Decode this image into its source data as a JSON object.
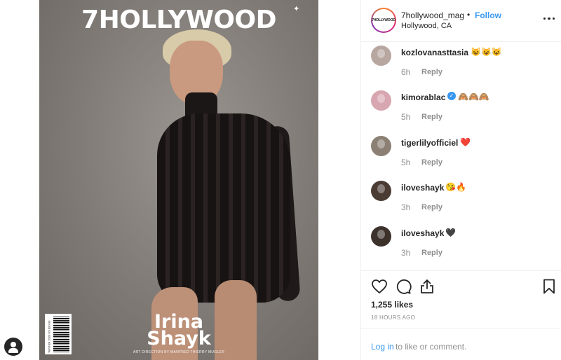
{
  "cover": {
    "brand": "7HOLLYWOOD",
    "name_line1": "Irina",
    "name_line2": "Shayk",
    "credit": "ART DIRECTION BY MANFRED THIERRY MUGLER",
    "issue": "WINTER 2020 US $20.00"
  },
  "post": {
    "avatar_logo": "7HOLLYWOOD",
    "username": "7hollywood_mag",
    "separator": "•",
    "follow_label": "Follow",
    "location": "Hollywood, CA"
  },
  "comments": [
    {
      "user": "kozlovanasttasia",
      "text": "😺😺😺",
      "time": "6h",
      "reply": "Reply",
      "verified": false,
      "avatar_color": "#b7a7a0"
    },
    {
      "user": "kimorablac",
      "text": "🙈🙈🙈",
      "time": "5h",
      "reply": "Reply",
      "verified": true,
      "avatar_color": "#d7a6b0"
    },
    {
      "user": "tigerlilyofficiel",
      "text": "❤️",
      "time": "5h",
      "reply": "Reply",
      "verified": false,
      "avatar_color": "#8b8073"
    },
    {
      "user": "iloveshayk",
      "text": "😘🔥",
      "time": "3h",
      "reply": "Reply",
      "verified": false,
      "avatar_color": "#4a3b33"
    },
    {
      "user": "iloveshayk",
      "text": "🖤",
      "time": "3h",
      "reply": "Reply",
      "verified": false,
      "avatar_color": "#3d312b"
    }
  ],
  "actions": {
    "likes": "1,255 likes",
    "time_ago": "18 HOURS AGO",
    "icons": [
      "heart-icon",
      "comment-icon",
      "share-icon",
      "bookmark-icon"
    ]
  },
  "login": {
    "link": "Log in",
    "rest": "to like or comment."
  }
}
